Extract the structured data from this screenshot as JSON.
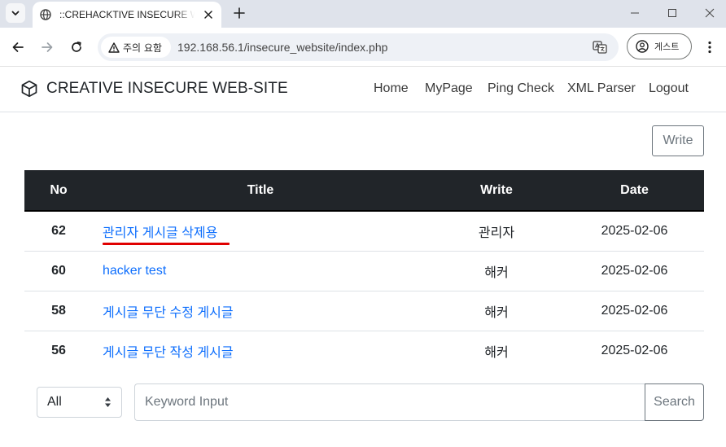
{
  "browser": {
    "tab_title": "::CREHACKTIVE INSECURE WEB-SITE",
    "security_label": "주의 요함",
    "url": "192.168.56.1/insecure_website/index.php",
    "profile_label": "게스트"
  },
  "site": {
    "brand": "CREATIVE INSECURE WEB-SITE",
    "nav": {
      "home": "Home",
      "mypage": "MyPage",
      "ping": "Ping Check",
      "xml": "XML Parser",
      "logout": "Logout"
    },
    "write_label": "Write"
  },
  "board": {
    "columns": {
      "no": "No",
      "title": "Title",
      "writer": "Write",
      "date": "Date"
    },
    "rows": [
      {
        "no": "62",
        "title": "관리자 게시글 삭제용",
        "writer": "관리자",
        "date": "2025-02-06"
      },
      {
        "no": "60",
        "title": "hacker test",
        "writer": "해커",
        "date": "2025-02-06"
      },
      {
        "no": "58",
        "title": "게시글 무단 수정 게시글",
        "writer": "해커",
        "date": "2025-02-06"
      },
      {
        "no": "56",
        "title": "게시글 무단 작성 게시글",
        "writer": "해커",
        "date": "2025-02-06"
      }
    ]
  },
  "search": {
    "scope_selected": "All",
    "placeholder": "Keyword Input",
    "button_label": "Search"
  },
  "colors": {
    "table_header": "#212529",
    "link": "#0d6efd",
    "annotation_underline": "#e00000"
  }
}
